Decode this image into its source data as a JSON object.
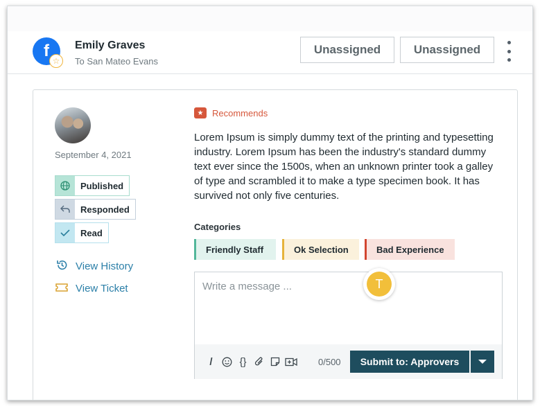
{
  "header": {
    "author_name": "Emily Graves",
    "author_sub": "To San Mateo Evans",
    "assign_1": "Unassigned",
    "assign_2": "Unassigned",
    "social_icon": "facebook-icon",
    "fb_letter": "f"
  },
  "post": {
    "date": "September 4, 2021",
    "statuses": [
      {
        "label": "Published",
        "icon": "globe-icon"
      },
      {
        "label": "Responded",
        "icon": "reply-icon"
      },
      {
        "label": "Read",
        "icon": "check-icon"
      }
    ],
    "links": [
      {
        "label": "View History",
        "icon": "history-icon"
      },
      {
        "label": "View Ticket",
        "icon": "ticket-icon"
      }
    ]
  },
  "review": {
    "type_label": "Recommends",
    "text": "Lorem Ipsum is simply dummy text of the printing and typesetting industry. Lorem Ipsum has been the industry's standard dummy text ever since the 1500s, when an unknown printer took a galley of type and scrambled it to make a type specimen book. It has survived not only five centuries.",
    "categories_label": "Categories",
    "categories": [
      "Friendly Staff",
      "Ok Selection",
      "Bad Experience"
    ]
  },
  "composer": {
    "placeholder": "Write a message ...",
    "counter": "0/500",
    "submit_label": "Submit to: Approvers"
  },
  "presence": {
    "initial": "T"
  },
  "colors": {
    "accent": "#1e4d5e",
    "link": "#2b7fa8",
    "recommends": "#d6573b",
    "presence": "#f2bf3a"
  }
}
